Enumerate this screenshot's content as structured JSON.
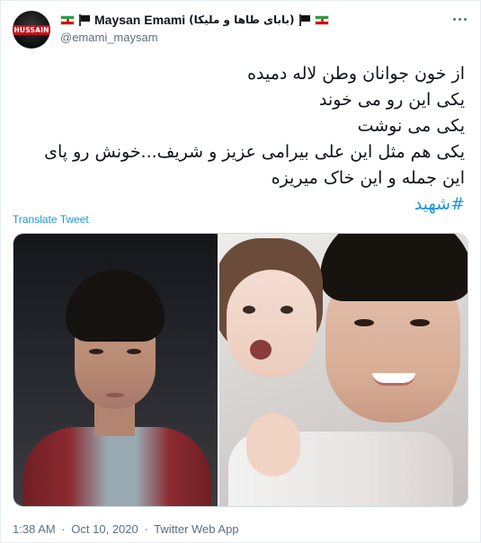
{
  "author": {
    "avatar_text": "HUSSAIN",
    "display_name_latin": "Maysan Emami",
    "display_name_persian": "(بابای طاها و ملیکا)",
    "handle": "@emami_maysam"
  },
  "tweet": {
    "lines": [
      "از خون جوانان وطن لاله دمیده",
      "یکی این رو می خوند",
      "یکی می نوشت",
      "یکی هم مثل این علی بیرامی عزیز و شریف...خونش رو پای",
      "این جمله و این خاک میریزه"
    ],
    "hashtag": "#شهید",
    "translate_label": "Translate Tweet"
  },
  "meta": {
    "time": "1:38 AM",
    "date": "Oct 10, 2020",
    "source": "Twitter Web App",
    "separator": "·"
  },
  "colors": {
    "link": "#1b95e0",
    "secondary_text": "#5b7083"
  },
  "icons": [
    "iran-flag-icon",
    "black-flag-icon",
    "more-options-icon"
  ]
}
